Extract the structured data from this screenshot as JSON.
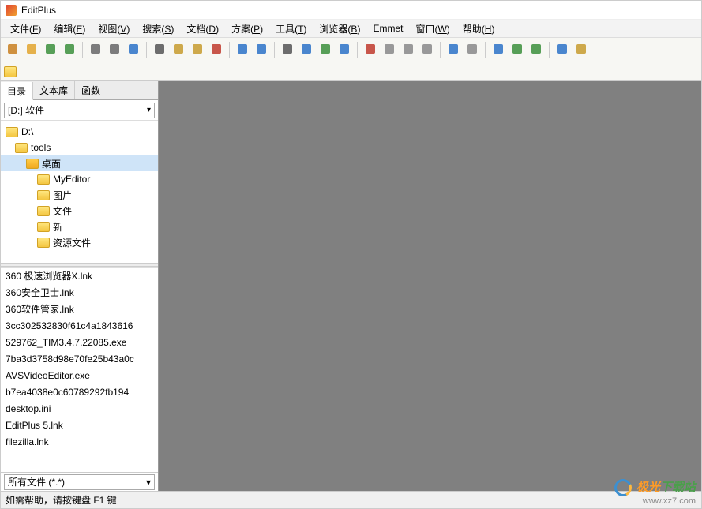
{
  "title": "EditPlus",
  "menus": [
    {
      "label": "文件",
      "key": "F"
    },
    {
      "label": "编辑",
      "key": "E"
    },
    {
      "label": "视图",
      "key": "V"
    },
    {
      "label": "搜索",
      "key": "S"
    },
    {
      "label": "文档",
      "key": "D"
    },
    {
      "label": "方案",
      "key": "P"
    },
    {
      "label": "工具",
      "key": "T"
    },
    {
      "label": "浏览器",
      "key": "B"
    },
    {
      "label": "Emmet",
      "key": ""
    },
    {
      "label": "窗口",
      "key": "W"
    },
    {
      "label": "帮助",
      "key": "H"
    }
  ],
  "toolbar_icons": [
    "new-file",
    "open-file",
    "save",
    "save-all",
    "sep",
    "print",
    "print-preview",
    "refresh",
    "sep",
    "cut",
    "copy",
    "paste",
    "delete",
    "sep",
    "undo",
    "redo",
    "sep",
    "find",
    "find-next",
    "replace",
    "go-to-line",
    "sep",
    "font-large",
    "font-small",
    "word-wrap",
    "ruler",
    "sep",
    "spell-check",
    "settings",
    "sep",
    "browser",
    "split-horizontal",
    "split-vertical",
    "sep",
    "help-pointer",
    "customize"
  ],
  "side_tabs": {
    "items": [
      "目录",
      "文本库",
      "函数"
    ],
    "active": 0
  },
  "drive": "[D:] 软件",
  "tree": [
    {
      "label": "D:\\",
      "level": 0,
      "open": false,
      "sel": false
    },
    {
      "label": "tools",
      "level": 1,
      "open": false,
      "sel": false
    },
    {
      "label": "桌面",
      "level": 2,
      "open": true,
      "sel": true
    },
    {
      "label": "MyEditor",
      "level": 3,
      "open": false,
      "sel": false
    },
    {
      "label": "图片",
      "level": 3,
      "open": false,
      "sel": false
    },
    {
      "label": "文件",
      "level": 3,
      "open": false,
      "sel": false
    },
    {
      "label": "新",
      "level": 3,
      "open": false,
      "sel": false
    },
    {
      "label": "资源文件",
      "level": 3,
      "open": false,
      "sel": false
    }
  ],
  "files": [
    "360 极速浏览器X.lnk",
    "360安全卫士.lnk",
    "360软件管家.lnk",
    "3cc302532830f61c4a1843616",
    "529762_TIM3.4.7.22085.exe",
    "7ba3d3758d98e70fe25b43a0c",
    "AVSVideoEditor.exe",
    "b7ea4038e0c60789292fb194",
    "desktop.ini",
    "EditPlus 5.lnk",
    "filezilla.lnk"
  ],
  "filter": "所有文件 (*.*)",
  "status": "如需帮助，请按键盘 F1 键",
  "watermark": {
    "brand_a": "极光",
    "brand_b": "下载站",
    "url": "www.xz7.com"
  }
}
